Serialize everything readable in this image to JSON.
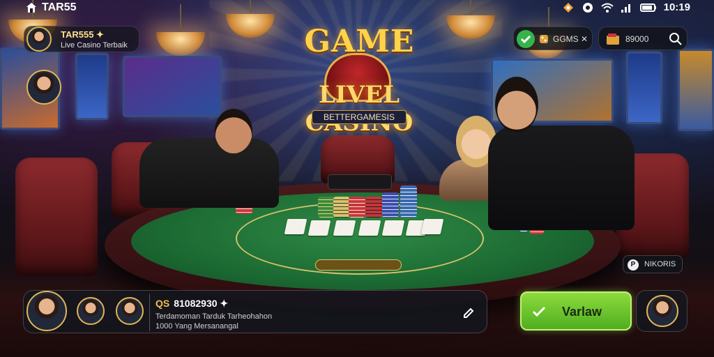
{
  "status_bar": {
    "brand": "TAR55",
    "time": "10:19"
  },
  "host": {
    "name": "TAR555 ✦",
    "subtitle": "Live Casino Terbaik"
  },
  "logo": {
    "title": "GAME",
    "main": "LIVEL CASINO",
    "sub": "BETTERGAMESIS"
  },
  "top_right": {
    "status_pill_text": "GGMS ✕",
    "balance_pill_text": "89000"
  },
  "mini_pill": {
    "icon_letter": "P",
    "text": "NIKORIS"
  },
  "bottom_bar": {
    "title": "81082930 ✦",
    "title_prefix": "QS",
    "line1": "Terdamoman  Tarduk  Tarheohahon",
    "line2_prefix": "1000",
    "line2": "Yang Mersanangal"
  },
  "main_button": {
    "label": "Varlaw"
  },
  "colors": {
    "accent_gold": "#e3b650",
    "button_green": "#5cbf26",
    "felt_green": "#1c6a33"
  }
}
